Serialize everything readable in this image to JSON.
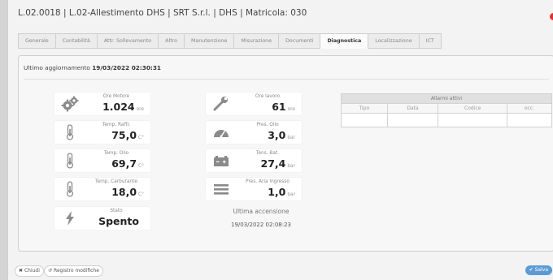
{
  "window": {
    "title": "L.02.0018 | L.02-Allestimento DHS | SRT S.r.l. | DHS | Matricola: 030"
  },
  "tabs": [
    {
      "label": "Generale"
    },
    {
      "label": "Contabilità"
    },
    {
      "label": "Attr. Sollevamento"
    },
    {
      "label": "Altro"
    },
    {
      "label": "Manutenzione"
    },
    {
      "label": "Misurazione"
    },
    {
      "label": "Documenti"
    },
    {
      "label": "Diagnostica",
      "active": true
    },
    {
      "label": "Localizzazione"
    },
    {
      "label": "ICT"
    }
  ],
  "diagnostics": {
    "update_label": "Ultimo aggiornamento",
    "update_value": "19/03/2022 02:30:31",
    "left": [
      {
        "label": "Ore Motore",
        "value": "1.024",
        "unit": "ore",
        "icon": "gears-icon"
      },
      {
        "label": "Temp. Raffr.",
        "value": "75,0",
        "unit": "C°",
        "icon": "thermometer-icon"
      },
      {
        "label": "Temp. Olio",
        "value": "69,7",
        "unit": "C°",
        "icon": "thermometer-icon"
      },
      {
        "label": "Temp. Carburante",
        "value": "18,0",
        "unit": "C°",
        "icon": "thermometer-icon"
      },
      {
        "label": "Stato",
        "value": "Spento",
        "unit": "",
        "icon": "lightning-icon"
      }
    ],
    "right": [
      {
        "label": "Ore lavoro",
        "value": "61",
        "unit": "ore",
        "icon": "wrench-icon"
      },
      {
        "label": "Pres. Olio",
        "value": "3,0",
        "unit": "bar",
        "icon": "gauge-icon"
      },
      {
        "label": "Tens. Bat.",
        "value": "27,4",
        "unit": "bar",
        "icon": "battery-icon"
      },
      {
        "label": "Pres. Aria Ingresso",
        "value": "1,0",
        "unit": "bar",
        "icon": "menu-lines-icon"
      }
    ],
    "last_ignition_label": "Ultima accensione",
    "last_ignition_value": "19/03/2022 02:08:23"
  },
  "alarms": {
    "title": "Allarmi attivi",
    "columns": [
      "Tipo",
      "Data",
      "Codice",
      "occ."
    ]
  },
  "footer": {
    "close_label": "Chiudi",
    "history_label": "Registro modifiche",
    "save_label": "Salva"
  },
  "colors": {
    "close_dot": "#e8312f",
    "save_button": "#5b9bd5",
    "icon": "#8a8a8a"
  }
}
